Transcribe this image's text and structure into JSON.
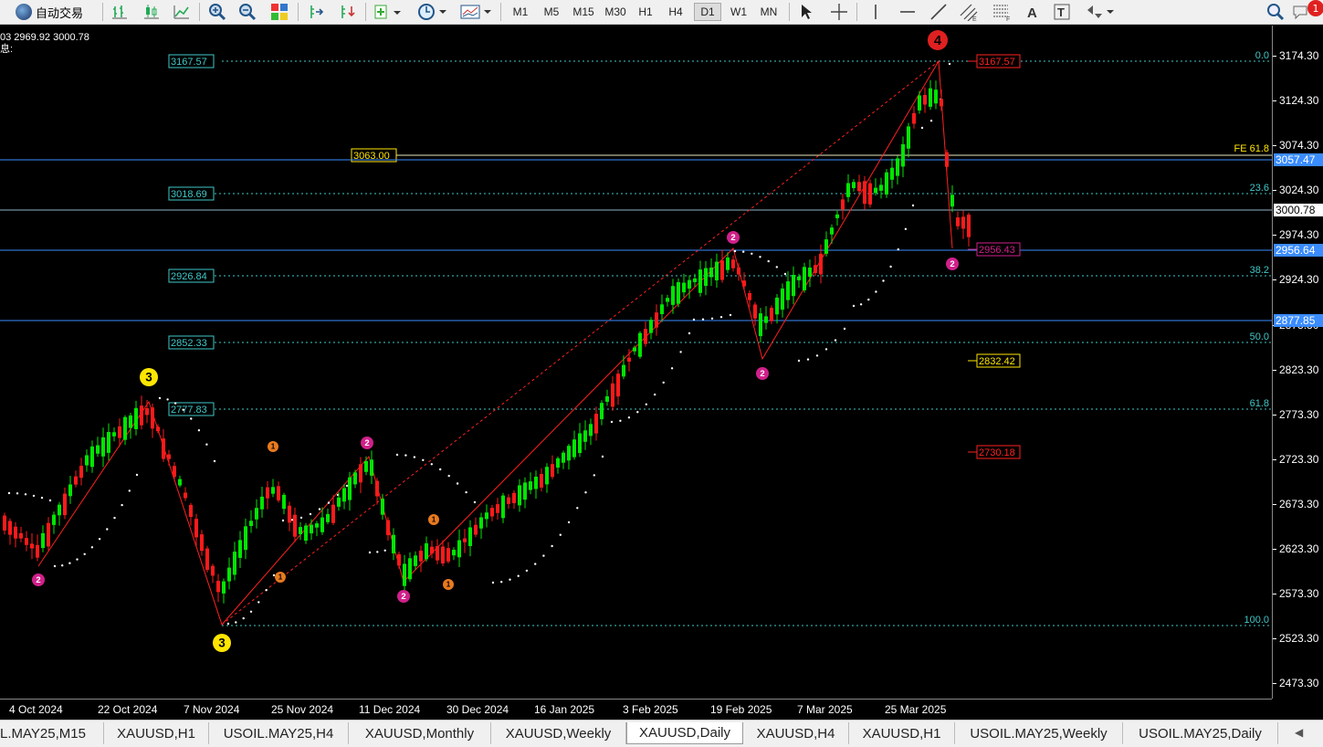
{
  "toolbar": {
    "autotrade_label": "自动交易",
    "timeframes": [
      "M1",
      "M5",
      "M15",
      "M30",
      "H1",
      "H4",
      "D1",
      "W1",
      "MN"
    ],
    "active_timeframe": "D1",
    "notification_count": "1"
  },
  "info_line1": "03 2969.92 3000.78",
  "info_line2": "息:",
  "price_axis": {
    "labels": [
      "3174.30",
      "3124.30",
      "3074.30",
      "3024.30",
      "2974.30",
      "2924.30",
      "2873.30",
      "2823.30",
      "2773.30",
      "2723.30",
      "2673.30",
      "2623.30",
      "2573.30",
      "2523.30",
      "2473.30"
    ],
    "current_price": "3000.78",
    "line_prices": [
      "3057.47",
      "2956.64",
      "2877.85"
    ]
  },
  "time_axis": [
    "4 Oct 2024",
    "22 Oct 2024",
    "7 Nov 2024",
    "25 Nov 2024",
    "11 Dec 2024",
    "30 Dec 2024",
    "16 Jan 2025",
    "3 Feb 2025",
    "19 Feb 2025",
    "7 Mar 2025",
    "25 Mar 2025"
  ],
  "fib_levels": [
    {
      "label": "0.0",
      "value": "3167.57"
    },
    {
      "label": "23.6",
      "value": "3018.69"
    },
    {
      "label": "38.2",
      "value": "2926.84"
    },
    {
      "label": "50.0",
      "value": "2852.33"
    },
    {
      "label": "61.8",
      "value": "2777.83"
    },
    {
      "label": "100.0",
      "value": ""
    }
  ],
  "fe_label": "FE 61.8",
  "fe_value": "3063.00",
  "target_labels": [
    "3167.57",
    "2956.43",
    "2832.42",
    "2730.18"
  ],
  "wave_labels": {
    "major": [
      {
        "text": "3"
      },
      {
        "text": "3"
      },
      {
        "text": "4"
      }
    ],
    "minor": [
      {
        "text": "2"
      },
      {
        "text": "2"
      },
      {
        "text": "2"
      },
      {
        "text": "2"
      },
      {
        "text": "2"
      },
      {
        "text": "2"
      }
    ],
    "sub": [
      {
        "text": "1"
      },
      {
        "text": "1"
      },
      {
        "text": "1"
      },
      {
        "text": "1"
      }
    ]
  },
  "tabs": [
    "L.MAY25,M15",
    "XAUUSD,H1",
    "USOIL.MAY25,H4",
    "XAUUSD,Monthly",
    "XAUUSD,Weekly",
    "XAUUSD,Daily",
    "XAUUSD,H4",
    "XAUUSD,H1",
    "USOIL.MAY25,Weekly",
    "USOIL.MAY25,Daily"
  ],
  "active_tab": "XAUUSD,Daily",
  "colors": {
    "bull": "#00e600",
    "bear": "#ff1a1a",
    "fib": "#40c8c8",
    "hline": "#3a8cff",
    "zigzag": "#ff2020",
    "major_wave": "#ffe600",
    "minor_wave": "#d0208a",
    "sub_wave": "#e87a1e"
  }
}
